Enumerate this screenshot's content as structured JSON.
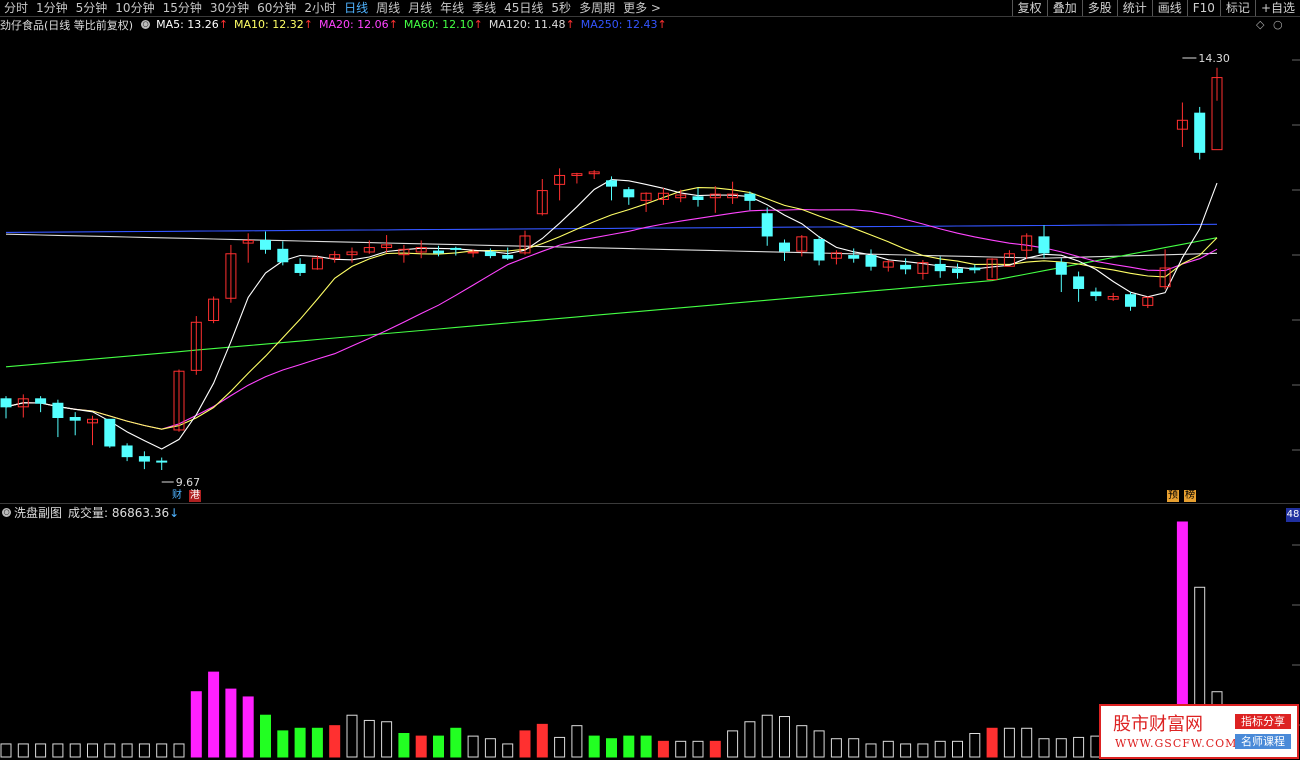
{
  "toolbar": {
    "periods": [
      "分时",
      "1分钟",
      "5分钟",
      "10分钟",
      "15分钟",
      "30分钟",
      "60分钟",
      "2小时",
      "日线",
      "周线",
      "月线",
      "年线",
      "季线",
      "45日线",
      "5秒",
      "多周期",
      "更多 >"
    ],
    "active": "日线",
    "right_buttons": [
      "复权",
      "叠加",
      "多股",
      "统计",
      "画线",
      "F10",
      "标记",
      "+自选"
    ]
  },
  "main": {
    "title": "劲仔食品(日线 等比前复权)",
    "ma": [
      {
        "label": "MA5: 13.26",
        "arrow": "↑",
        "color": "#ffffff"
      },
      {
        "label": "MA10: 12.32",
        "arrow": "↑",
        "color": "#ffff66"
      },
      {
        "label": "MA20: 12.06",
        "arrow": "↑",
        "color": "#ff44ff"
      },
      {
        "label": "MA60: 12.10",
        "arrow": "↑",
        "color": "#44ff44"
      },
      {
        "label": "MA120: 11.48",
        "arrow": "↑",
        "color": "#dddddd"
      },
      {
        "label": "MA250: 12.43",
        "arrow": "↑",
        "color": "#3355ff"
      }
    ],
    "high_label": "14.30",
    "low_label": "9.67",
    "badges": [
      "财",
      "港",
      "预",
      "榜"
    ]
  },
  "volume": {
    "title": "洗盘副图",
    "label": "成交量: 86863.36",
    "arrow": "↓",
    "axis_value": "48"
  },
  "watermark": {
    "title": "股市财富网",
    "url": "WWW.GSCFW.COM",
    "tag1": "指标分享",
    "tag2": "名师课程"
  },
  "colors": {
    "up": "#ff3030",
    "down": "#54ffff",
    "ma5": "#ffffff",
    "ma10": "#ffff66",
    "ma20": "#ff44ff",
    "ma60": "#44ff44",
    "ma120": "#dddddd",
    "ma250": "#3355ff",
    "vol_magenta": "#ff20ff",
    "vol_green": "#22ff22"
  },
  "chart_data": {
    "type": "candlestick",
    "ohlc": [
      [
        10.47,
        10.5,
        10.25,
        10.38
      ],
      [
        10.38,
        10.52,
        10.26,
        10.47
      ],
      [
        10.47,
        10.5,
        10.32,
        10.42
      ],
      [
        10.42,
        10.46,
        10.04,
        10.26
      ],
      [
        10.26,
        10.32,
        10.06,
        10.23
      ],
      [
        10.2,
        10.28,
        9.95,
        10.24
      ],
      [
        10.24,
        10.24,
        9.92,
        9.94
      ],
      [
        9.94,
        9.97,
        9.77,
        9.82
      ],
      [
        9.82,
        9.88,
        9.68,
        9.77
      ],
      [
        9.77,
        9.81,
        9.67,
        9.76
      ],
      [
        10.12,
        10.8,
        10.1,
        10.78
      ],
      [
        10.79,
        11.4,
        10.74,
        11.33
      ],
      [
        11.35,
        11.62,
        11.32,
        11.59
      ],
      [
        11.6,
        12.2,
        11.55,
        12.1
      ],
      [
        12.22,
        12.33,
        12.0,
        12.25
      ],
      [
        12.25,
        12.35,
        12.1,
        12.15
      ],
      [
        12.15,
        12.24,
        11.97,
        12.01
      ],
      [
        11.98,
        12.05,
        11.85,
        11.89
      ],
      [
        11.93,
        12.08,
        11.92,
        12.05
      ],
      [
        12.05,
        12.13,
        12.0,
        12.09
      ],
      [
        12.09,
        12.17,
        12.0,
        12.12
      ],
      [
        12.12,
        12.25,
        12.1,
        12.17
      ],
      [
        12.17,
        12.31,
        12.11,
        12.2
      ],
      [
        12.09,
        12.2,
        12.0,
        12.15
      ],
      [
        12.12,
        12.25,
        12.05,
        12.17
      ],
      [
        12.13,
        12.19,
        12.07,
        12.11
      ],
      [
        12.16,
        12.18,
        12.08,
        12.15
      ],
      [
        12.11,
        12.15,
        12.06,
        12.12
      ],
      [
        12.12,
        12.16,
        12.05,
        12.08
      ],
      [
        12.08,
        12.17,
        12.03,
        12.05
      ],
      [
        12.11,
        12.36,
        12.09,
        12.3
      ],
      [
        12.55,
        12.94,
        12.53,
        12.81
      ],
      [
        12.88,
        13.06,
        12.7,
        12.98
      ],
      [
        12.98,
        13.01,
        12.89,
        13.0
      ],
      [
        13.0,
        13.04,
        12.94,
        13.02
      ],
      [
        12.92,
        12.97,
        12.7,
        12.86
      ],
      [
        12.82,
        12.85,
        12.65,
        12.74
      ],
      [
        12.7,
        12.79,
        12.57,
        12.78
      ],
      [
        12.71,
        12.84,
        12.65,
        12.78
      ],
      [
        12.73,
        12.82,
        12.68,
        12.76
      ],
      [
        12.74,
        12.84,
        12.63,
        12.71
      ],
      [
        12.73,
        12.86,
        12.56,
        12.77
      ],
      [
        12.73,
        12.91,
        12.66,
        12.77
      ],
      [
        12.77,
        12.8,
        12.59,
        12.7
      ],
      [
        12.55,
        12.62,
        12.19,
        12.3
      ],
      [
        12.22,
        12.26,
        12.02,
        12.13
      ],
      [
        12.13,
        12.31,
        12.07,
        12.29
      ],
      [
        12.26,
        12.3,
        11.97,
        12.03
      ],
      [
        12.05,
        12.14,
        11.98,
        12.11
      ],
      [
        12.08,
        12.16,
        12.0,
        12.05
      ],
      [
        12.08,
        12.15,
        11.91,
        11.96
      ],
      [
        11.95,
        12.03,
        11.9,
        12.01
      ],
      [
        11.97,
        12.05,
        11.87,
        11.93
      ],
      [
        11.88,
        12.03,
        11.81,
        12.0
      ],
      [
        11.98,
        12.07,
        11.83,
        11.91
      ],
      [
        11.93,
        11.99,
        11.82,
        11.89
      ],
      [
        11.94,
        11.98,
        11.88,
        11.92
      ],
      [
        11.81,
        12.05,
        11.83,
        12.04
      ],
      [
        11.96,
        12.14,
        12.06,
        12.1
      ],
      [
        12.14,
        12.33,
        12.04,
        12.3
      ],
      [
        12.29,
        12.42,
        12.05,
        12.11
      ],
      [
        12.0,
        12.05,
        11.67,
        11.87
      ],
      [
        11.84,
        11.9,
        11.56,
        11.71
      ],
      [
        11.67,
        11.72,
        11.57,
        11.63
      ],
      [
        11.59,
        11.66,
        11.57,
        11.62
      ],
      [
        11.64,
        11.67,
        11.46,
        11.51
      ],
      [
        11.52,
        11.62,
        11.49,
        11.61
      ],
      [
        11.73,
        12.15,
        11.7,
        11.94
      ],
      [
        13.5,
        13.8,
        13.3,
        13.6
      ],
      [
        13.68,
        13.75,
        13.16,
        13.24
      ],
      [
        13.27,
        14.19,
        13.82,
        14.08
      ]
    ],
    "volume": [
      10,
      10,
      10,
      10,
      10,
      10,
      10,
      10,
      10,
      10,
      10,
      50,
      65,
      52,
      46,
      32,
      20,
      22,
      22,
      24,
      32,
      28,
      27,
      18,
      16,
      16,
      22,
      16,
      14,
      10,
      20,
      25,
      15,
      24,
      16,
      14,
      16,
      16,
      12,
      12,
      12,
      12,
      20,
      27,
      32,
      31,
      24,
      20,
      14,
      14,
      10,
      12,
      10,
      10,
      12,
      12,
      18,
      22,
      22,
      22,
      14,
      14,
      15,
      16,
      15,
      10,
      10,
      16,
      180,
      130,
      50
    ],
    "volume_colors": [
      "o",
      "o",
      "o",
      "o",
      "o",
      "o",
      "o",
      "o",
      "o",
      "o",
      "o",
      "m",
      "m",
      "m",
      "m",
      "g",
      "g",
      "g",
      "g",
      "r",
      "o",
      "o",
      "o",
      "g",
      "r",
      "g",
      "g",
      "o",
      "o",
      "o",
      "r",
      "r",
      "o",
      "o",
      "g",
      "g",
      "g",
      "g",
      "r",
      "o",
      "o",
      "r",
      "o",
      "o",
      "o",
      "o",
      "o",
      "o",
      "o",
      "o",
      "o",
      "o",
      "o",
      "o",
      "o",
      "o",
      "o",
      "r",
      "o",
      "o",
      "o",
      "o",
      "o",
      "o",
      "o",
      "o",
      "o",
      "m",
      "m",
      "o",
      "o"
    ],
    "high": 14.3,
    "low": 9.67
  }
}
